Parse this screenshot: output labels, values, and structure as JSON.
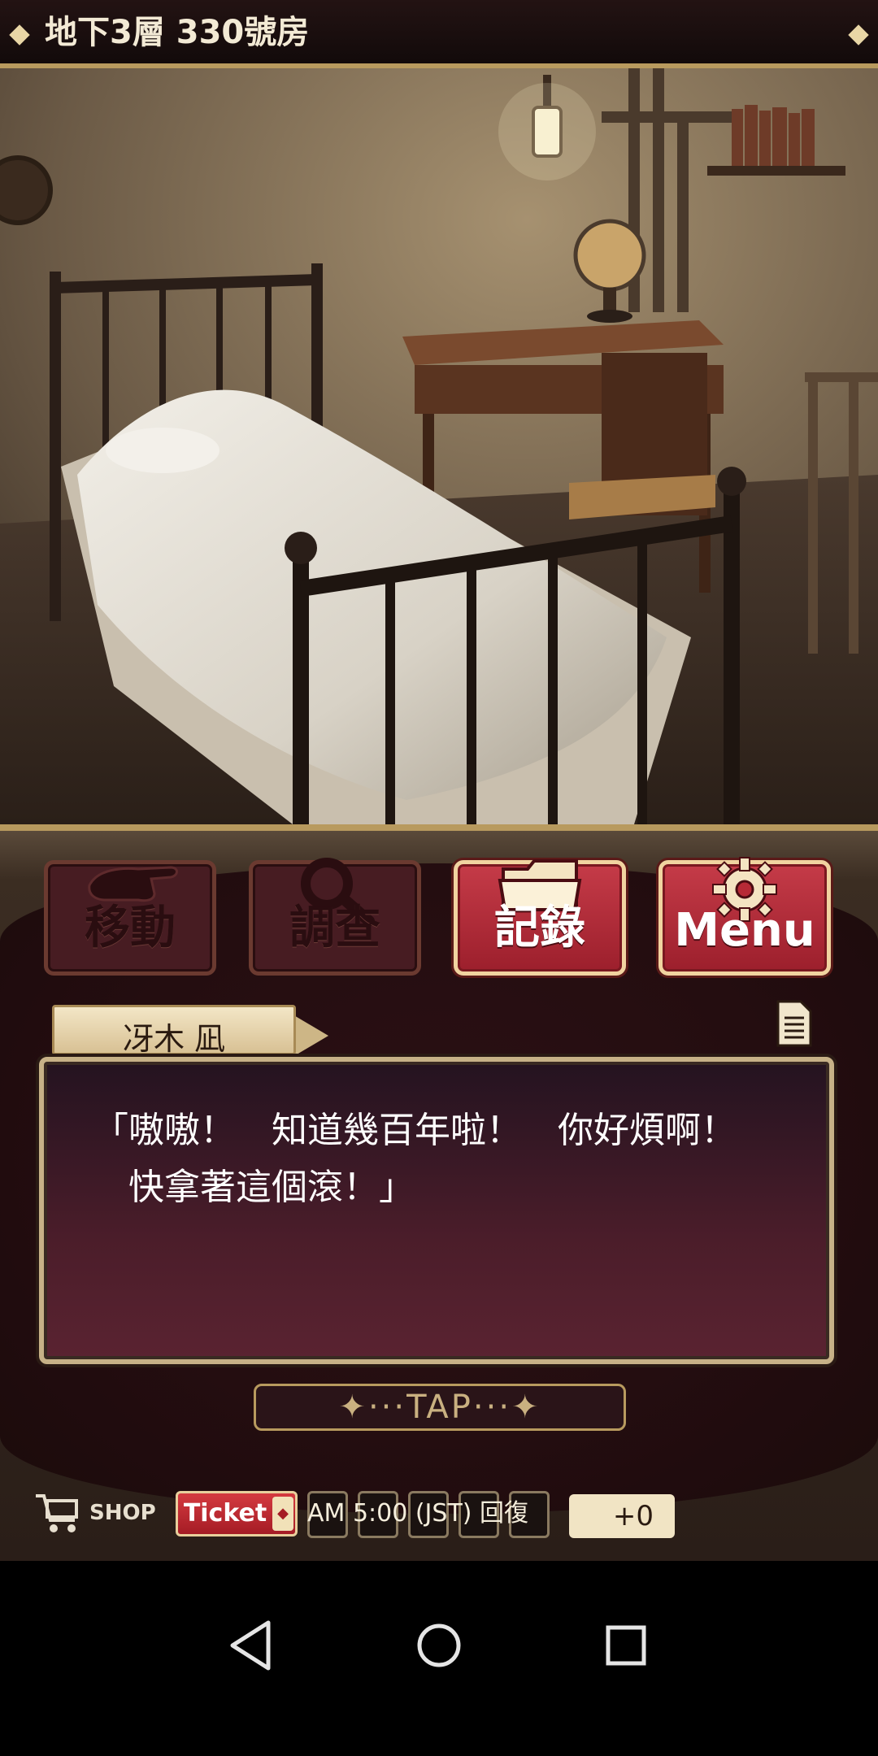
{
  "location": {
    "title": "地下3層 330號房"
  },
  "commands": [
    {
      "label": "移動",
      "icon": "hand-icon",
      "active": false
    },
    {
      "label": "調查",
      "icon": "magnifier-icon",
      "active": false
    },
    {
      "label": "記錄",
      "icon": "folder-icon",
      "active": true
    },
    {
      "label": "Menu",
      "icon": "gear-icon",
      "active": true
    }
  ],
  "dialog": {
    "speaker": "冴木 凪",
    "text": "「嗷嗷！　知道幾百年啦！　你好煩啊！\n　快拿著這個滾！」",
    "advance_label": "✦···TAP···✦"
  },
  "footer": {
    "shop_label": "SHOP",
    "ticket_label": "Ticket",
    "recover_text": "AM 5:00 (JST) 回復",
    "count": "+0"
  },
  "colors": {
    "accent_red": "#b72a36",
    "gold_border": "#b89a5e",
    "panel_dark": "#2b1014"
  }
}
